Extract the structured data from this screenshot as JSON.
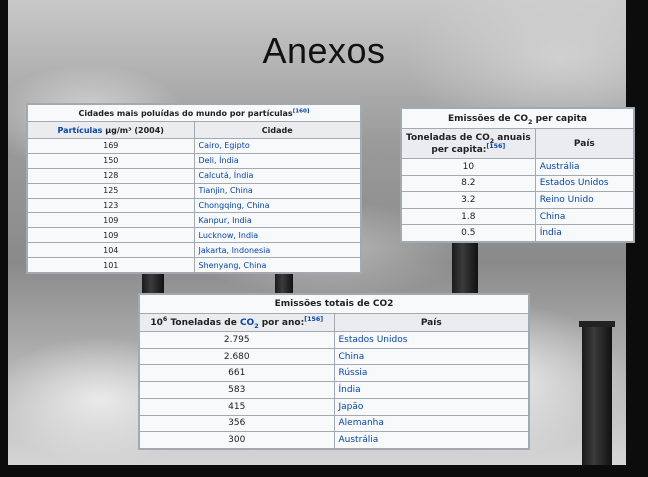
{
  "slide": {
    "title": "Anexos"
  },
  "table_cities": {
    "caption": "Cidades mais poluídas do mundo por partículas",
    "caption_ref": "[160]",
    "header_value_link": "Partículas",
    "header_value_rest": " µg/m³ (2004)",
    "header_city": "Cidade",
    "rows": [
      {
        "value": "169",
        "city": "Cairo, Egipto"
      },
      {
        "value": "150",
        "city": "Deli, Índia"
      },
      {
        "value": "128",
        "city": "Calcutá, Índia"
      },
      {
        "value": "125",
        "city": "Tianjin, China"
      },
      {
        "value": "123",
        "city": "Chongqing, China"
      },
      {
        "value": "109",
        "city": "Kanpur, India"
      },
      {
        "value": "109",
        "city": "Lucknow, India"
      },
      {
        "value": "104",
        "city": "Jakarta, Indonesia"
      },
      {
        "value": "101",
        "city": "Shenyang, China"
      }
    ]
  },
  "table_percapita": {
    "caption_pre": "Emissões de CO",
    "caption_sub": "2",
    "caption_post": " per capita",
    "header_value_pre": "Toneladas de CO",
    "header_value_sub": "2",
    "header_value_post": " anuais",
    "header_value_line2": "per capita:",
    "header_value_ref": "[156]",
    "header_country": "País",
    "rows": [
      {
        "value": "10",
        "country": "Austrália"
      },
      {
        "value": "8.2",
        "country": "Estados Unidos"
      },
      {
        "value": "3.2",
        "country": "Reino Unido"
      },
      {
        "value": "1.8",
        "country": "China"
      },
      {
        "value": "0.5",
        "country": "Índia"
      }
    ]
  },
  "table_totals": {
    "caption": "Emissões totais de CO2",
    "header_value_base": "10",
    "header_value_exp": "6",
    "header_value_mid": " Toneladas de ",
    "header_value_co": "CO",
    "header_value_sub": "2",
    "header_value_post": " por ano:",
    "header_value_ref": "[156]",
    "header_country": "País",
    "rows": [
      {
        "value": "2.795",
        "country": "Estados Unidos"
      },
      {
        "value": "2.680",
        "country": "China"
      },
      {
        "value": "661",
        "country": "Rússia"
      },
      {
        "value": "583",
        "country": "Índia"
      },
      {
        "value": "415",
        "country": "Japão"
      },
      {
        "value": "356",
        "country": "Alemanha"
      },
      {
        "value": "300",
        "country": "Austrália"
      }
    ]
  }
}
